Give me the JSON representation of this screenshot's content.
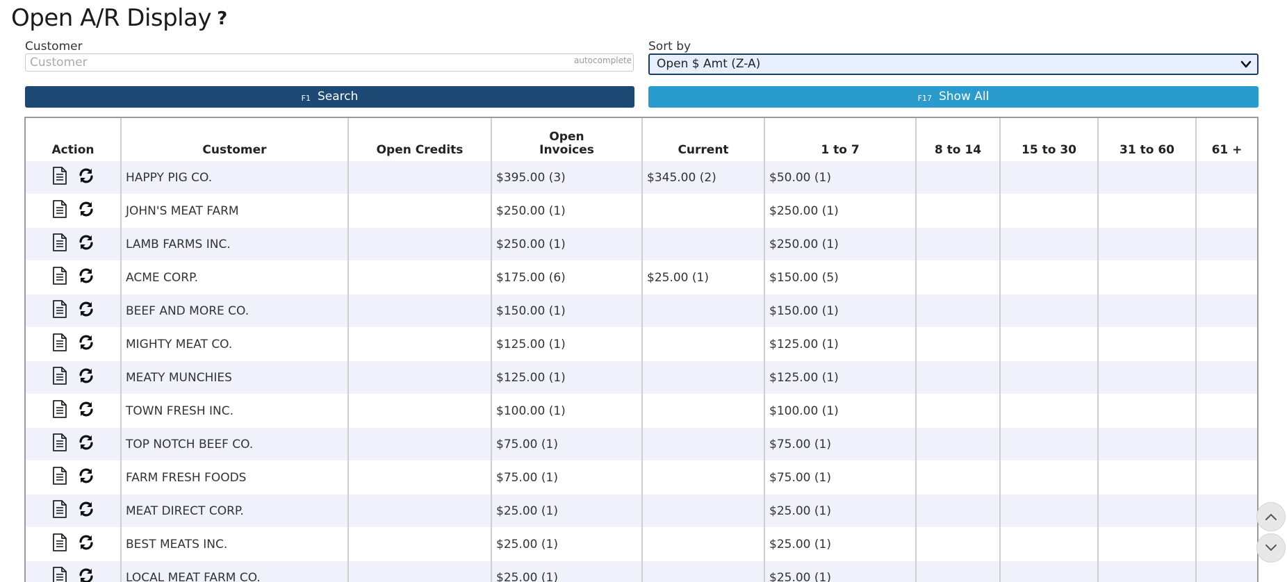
{
  "page": {
    "title": "Open A/R Display",
    "help": "?"
  },
  "filters": {
    "customer_label": "Customer",
    "customer_placeholder": "Customer",
    "customer_value": "",
    "autocomplete_hint": "autocomplete",
    "sort_label": "Sort by",
    "sort_selected": "Open $ Amt (Z-A)"
  },
  "buttons": {
    "search_key": "F1",
    "search_label": "Search",
    "showall_key": "F17",
    "showall_label": "Show All"
  },
  "table": {
    "headers": {
      "action": "Action",
      "customer": "Customer",
      "open_credits": "Open Credits",
      "open_invoices_line1": "Open",
      "open_invoices_line2": "Invoices",
      "current": "Current",
      "d1_7": "1 to 7",
      "d8_14": "8 to 14",
      "d15_30": "15 to 30",
      "d31_60": "31 to 60",
      "d61": "61 +"
    },
    "rows": [
      {
        "customer": "HAPPY PIG CO.",
        "open_credits": "",
        "open_invoices": "$395.00 (3)",
        "current": "$345.00 (2)",
        "d1_7": "$50.00 (1)",
        "d8_14": "",
        "d15_30": "",
        "d31_60": "",
        "d61": ""
      },
      {
        "customer": "JOHN'S MEAT FARM",
        "open_credits": "",
        "open_invoices": "$250.00 (1)",
        "current": "",
        "d1_7": "$250.00 (1)",
        "d8_14": "",
        "d15_30": "",
        "d31_60": "",
        "d61": ""
      },
      {
        "customer": "LAMB FARMS INC.",
        "open_credits": "",
        "open_invoices": "$250.00 (1)",
        "current": "",
        "d1_7": "$250.00 (1)",
        "d8_14": "",
        "d15_30": "",
        "d31_60": "",
        "d61": ""
      },
      {
        "customer": "ACME CORP.",
        "open_credits": "",
        "open_invoices": "$175.00 (6)",
        "current": "$25.00 (1)",
        "d1_7": "$150.00 (5)",
        "d8_14": "",
        "d15_30": "",
        "d31_60": "",
        "d61": ""
      },
      {
        "customer": "BEEF AND MORE CO.",
        "open_credits": "",
        "open_invoices": "$150.00 (1)",
        "current": "",
        "d1_7": "$150.00 (1)",
        "d8_14": "",
        "d15_30": "",
        "d31_60": "",
        "d61": ""
      },
      {
        "customer": "MIGHTY MEAT CO.",
        "open_credits": "",
        "open_invoices": "$125.00 (1)",
        "current": "",
        "d1_7": "$125.00 (1)",
        "d8_14": "",
        "d15_30": "",
        "d31_60": "",
        "d61": ""
      },
      {
        "customer": "MEATY MUNCHIES",
        "open_credits": "",
        "open_invoices": "$125.00 (1)",
        "current": "",
        "d1_7": "$125.00 (1)",
        "d8_14": "",
        "d15_30": "",
        "d31_60": "",
        "d61": ""
      },
      {
        "customer": "TOWN FRESH INC.",
        "open_credits": "",
        "open_invoices": "$100.00 (1)",
        "current": "",
        "d1_7": "$100.00 (1)",
        "d8_14": "",
        "d15_30": "",
        "d31_60": "",
        "d61": ""
      },
      {
        "customer": "TOP NOTCH BEEF CO.",
        "open_credits": "",
        "open_invoices": "$75.00 (1)",
        "current": "",
        "d1_7": "$75.00 (1)",
        "d8_14": "",
        "d15_30": "",
        "d31_60": "",
        "d61": ""
      },
      {
        "customer": "FARM FRESH FOODS",
        "open_credits": "",
        "open_invoices": "$75.00 (1)",
        "current": "",
        "d1_7": "$75.00 (1)",
        "d8_14": "",
        "d15_30": "",
        "d31_60": "",
        "d61": ""
      },
      {
        "customer": "MEAT DIRECT CORP.",
        "open_credits": "",
        "open_invoices": "$25.00 (1)",
        "current": "",
        "d1_7": "$25.00 (1)",
        "d8_14": "",
        "d15_30": "",
        "d31_60": "",
        "d61": ""
      },
      {
        "customer": "BEST MEATS INC.",
        "open_credits": "",
        "open_invoices": "$25.00 (1)",
        "current": "",
        "d1_7": "$25.00 (1)",
        "d8_14": "",
        "d15_30": "",
        "d31_60": "",
        "d61": ""
      },
      {
        "customer": "LOCAL MEAT FARM CO.",
        "open_credits": "",
        "open_invoices": "$25.00 (1)",
        "current": "",
        "d1_7": "$25.00 (1)",
        "d8_14": "",
        "d15_30": "",
        "d31_60": "",
        "d61": ""
      }
    ],
    "row_icons": [
      "document-icon",
      "refresh-icon"
    ]
  },
  "scroll_buttons": [
    "scroll-up-icon",
    "scroll-down-icon"
  ]
}
